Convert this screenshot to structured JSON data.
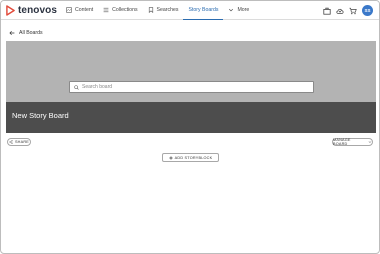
{
  "brand": {
    "name": "tenovos",
    "color": "#e24b3b"
  },
  "nav": {
    "items": [
      {
        "label": "Content",
        "icon": "content-icon"
      },
      {
        "label": "Collections",
        "icon": "collections-icon"
      },
      {
        "label": "Searches",
        "icon": "bookmark-icon"
      },
      {
        "label": "Story Boards",
        "icon": "storyboard-icon",
        "active": true
      },
      {
        "label": "More",
        "icon": "chevron-down-icon"
      }
    ],
    "active_color": "#2b6cb0"
  },
  "user": {
    "initials": "SS",
    "avatar_color": "#3a78c9"
  },
  "back": {
    "label": "All Boards"
  },
  "hero": {
    "search_placeholder": "Search board",
    "title": "New Story Board"
  },
  "actions": {
    "share_label": "SHARE",
    "manage_label": "MANAGE BOARD",
    "add_label": "ADD STORYBLOCK"
  }
}
